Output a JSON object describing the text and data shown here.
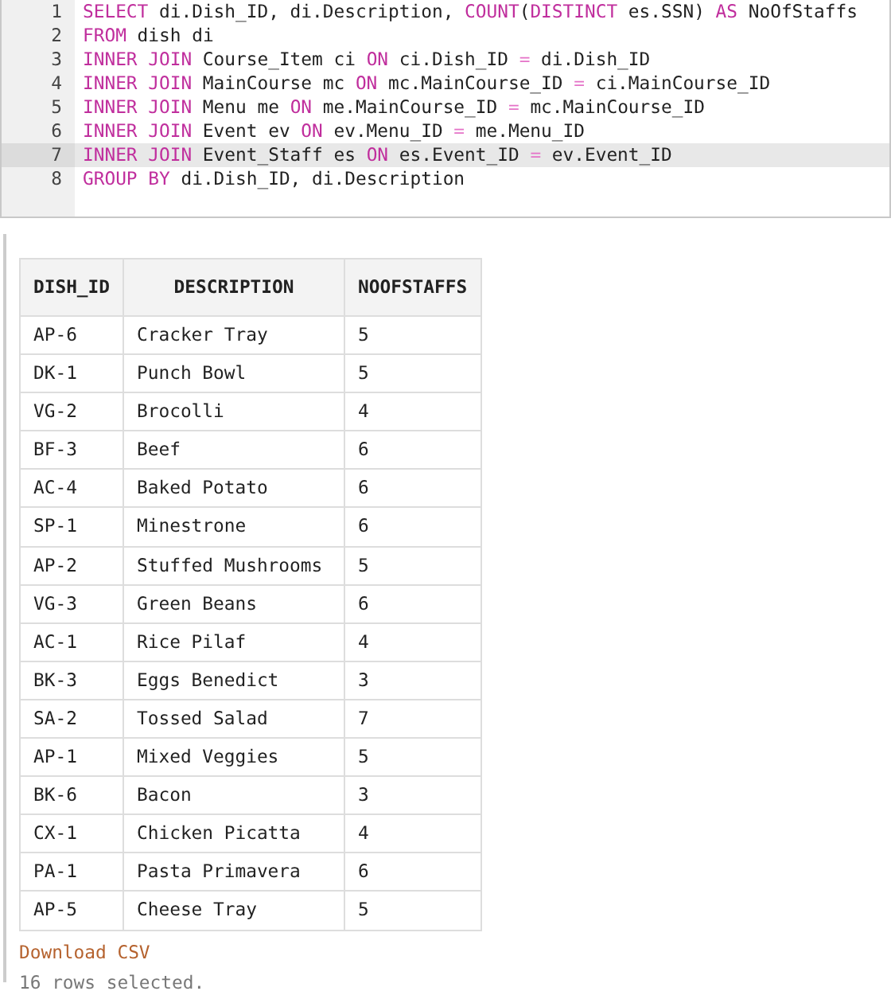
{
  "editor": {
    "lines": [
      {
        "number": "1",
        "selected": false,
        "tokens": [
          {
            "kind": "keyword",
            "text": "SELECT"
          },
          {
            "kind": "plain",
            "text": " di.Dish_ID, di.Description, "
          },
          {
            "kind": "keyword",
            "text": "COUNT"
          },
          {
            "kind": "plain",
            "text": "("
          },
          {
            "kind": "keyword",
            "text": "DISTINCT"
          },
          {
            "kind": "plain",
            "text": " es.SSN) "
          },
          {
            "kind": "keyword",
            "text": "AS"
          },
          {
            "kind": "plain",
            "text": " NoOfStaffs"
          }
        ]
      },
      {
        "number": "2",
        "selected": false,
        "tokens": [
          {
            "kind": "keyword",
            "text": "FROM"
          },
          {
            "kind": "plain",
            "text": " dish di"
          }
        ]
      },
      {
        "number": "3",
        "selected": false,
        "tokens": [
          {
            "kind": "keyword",
            "text": "INNER JOIN"
          },
          {
            "kind": "plain",
            "text": " Course_Item ci "
          },
          {
            "kind": "keyword",
            "text": "ON"
          },
          {
            "kind": "plain",
            "text": " ci.Dish_ID "
          },
          {
            "kind": "operator",
            "text": "="
          },
          {
            "kind": "plain",
            "text": " di.Dish_ID"
          }
        ]
      },
      {
        "number": "4",
        "selected": false,
        "tokens": [
          {
            "kind": "keyword",
            "text": "INNER JOIN"
          },
          {
            "kind": "plain",
            "text": " MainCourse mc "
          },
          {
            "kind": "keyword",
            "text": "ON"
          },
          {
            "kind": "plain",
            "text": " mc.MainCourse_ID "
          },
          {
            "kind": "operator",
            "text": "="
          },
          {
            "kind": "plain",
            "text": " ci.MainCourse_ID"
          }
        ]
      },
      {
        "number": "5",
        "selected": false,
        "tokens": [
          {
            "kind": "keyword",
            "text": "INNER JOIN"
          },
          {
            "kind": "plain",
            "text": " Menu me "
          },
          {
            "kind": "keyword",
            "text": "ON"
          },
          {
            "kind": "plain",
            "text": " me.MainCourse_ID "
          },
          {
            "kind": "operator",
            "text": "="
          },
          {
            "kind": "plain",
            "text": " mc.MainCourse_ID"
          }
        ]
      },
      {
        "number": "6",
        "selected": false,
        "tokens": [
          {
            "kind": "keyword",
            "text": "INNER JOIN"
          },
          {
            "kind": "plain",
            "text": " Event ev "
          },
          {
            "kind": "keyword",
            "text": "ON"
          },
          {
            "kind": "plain",
            "text": " ev.Menu_ID "
          },
          {
            "kind": "operator",
            "text": "="
          },
          {
            "kind": "plain",
            "text": " me.Menu_ID"
          }
        ]
      },
      {
        "number": "7",
        "selected": true,
        "tokens": [
          {
            "kind": "keyword",
            "text": "INNER JOIN"
          },
          {
            "kind": "plain",
            "text": " Event_Staff es "
          },
          {
            "kind": "keyword",
            "text": "ON"
          },
          {
            "kind": "plain",
            "text": " es.Event_ID "
          },
          {
            "kind": "operator",
            "text": "="
          },
          {
            "kind": "plain",
            "text": " ev.Event_ID"
          }
        ]
      },
      {
        "number": "8",
        "selected": false,
        "tokens": [
          {
            "kind": "keyword",
            "text": "GROUP BY"
          },
          {
            "kind": "plain",
            "text": " di.Dish_ID, di.Description"
          }
        ]
      }
    ]
  },
  "results": {
    "columns": [
      "DISH_ID",
      "DESCRIPTION",
      "NOOFSTAFFS"
    ],
    "rows": [
      [
        "AP-6",
        "Cracker Tray",
        "5"
      ],
      [
        "DK-1",
        "Punch Bowl",
        "5"
      ],
      [
        "VG-2",
        "Brocolli",
        "4"
      ],
      [
        "BF-3",
        "Beef",
        "6"
      ],
      [
        "AC-4",
        "Baked Potato",
        "6"
      ],
      [
        "SP-1",
        "Minestrone",
        "6"
      ],
      [
        "AP-2",
        "Stuffed Mushrooms",
        "5"
      ],
      [
        "VG-3",
        "Green Beans",
        "6"
      ],
      [
        "AC-1",
        "Rice Pilaf",
        "4"
      ],
      [
        "BK-3",
        "Eggs Benedict",
        "3"
      ],
      [
        "SA-2",
        "Tossed Salad",
        "7"
      ],
      [
        "AP-1",
        "Mixed Veggies",
        "5"
      ],
      [
        "BK-6",
        "Bacon",
        "3"
      ],
      [
        "CX-1",
        "Chicken Picatta",
        "4"
      ],
      [
        "PA-1",
        "Pasta Primavera",
        "6"
      ],
      [
        "AP-5",
        "Cheese Tray",
        "5"
      ]
    ],
    "download_link": "Download CSV",
    "row_count": "16 rows selected."
  }
}
